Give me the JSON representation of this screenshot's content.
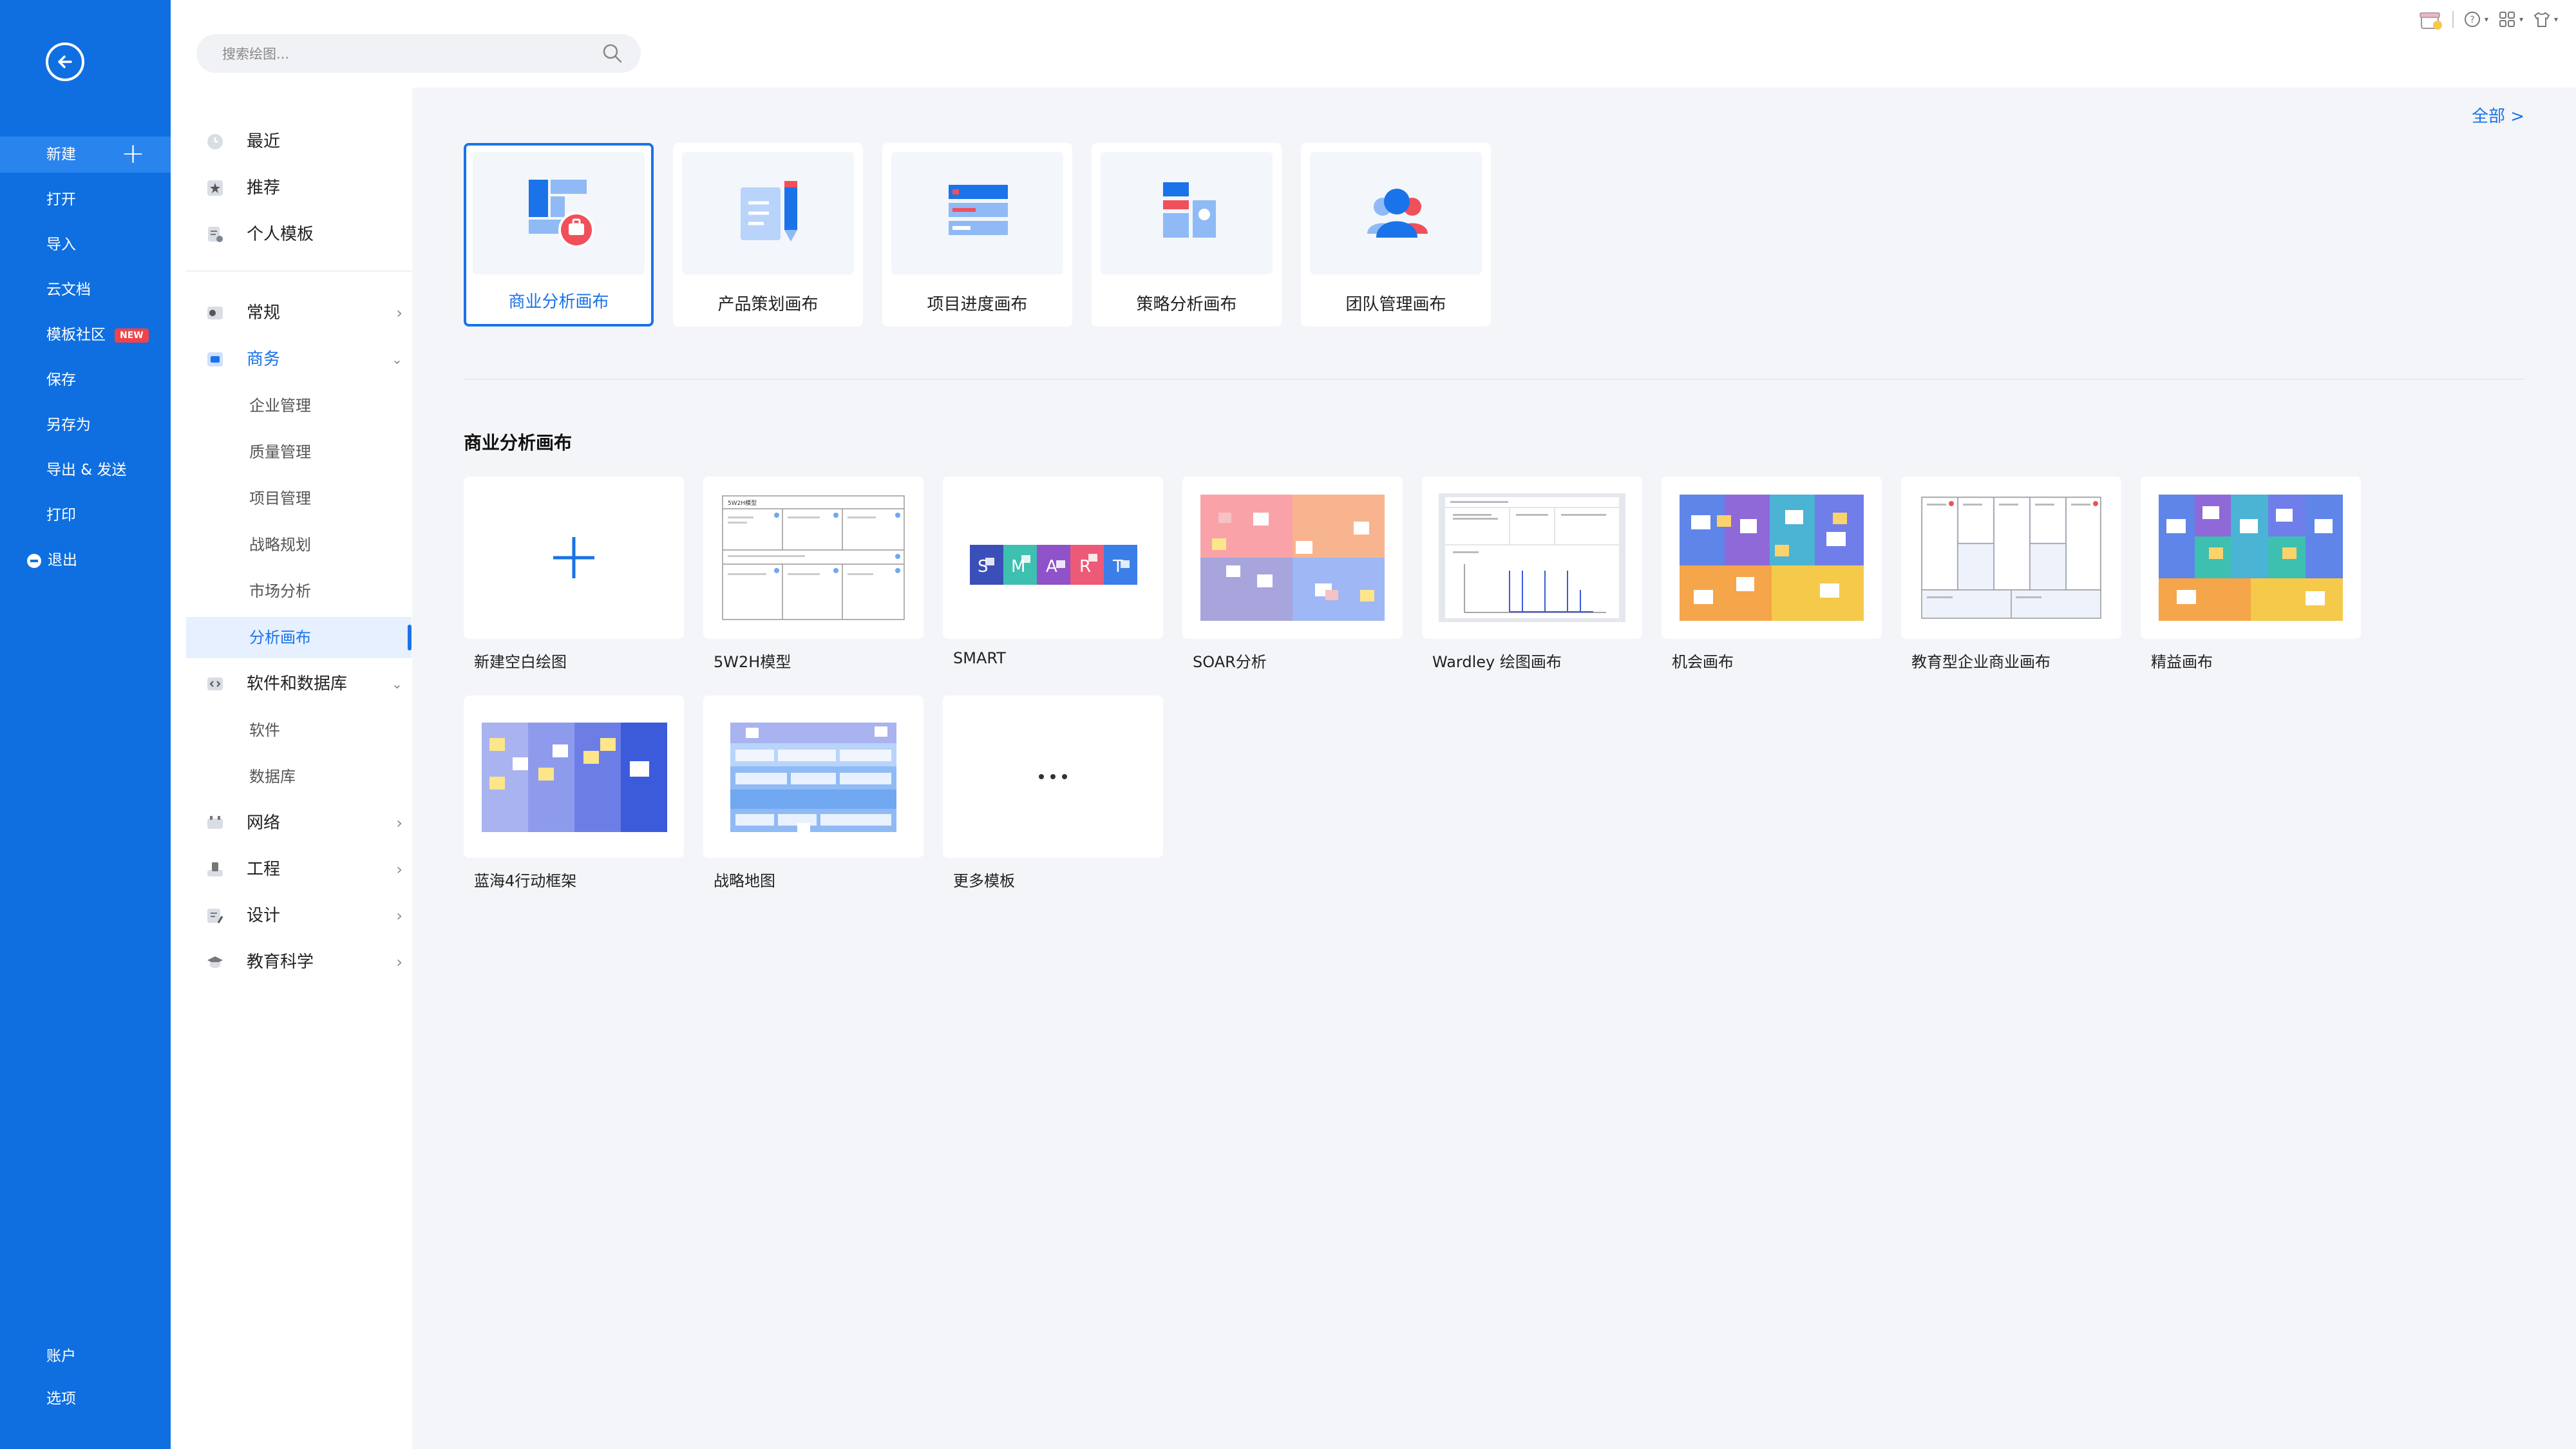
{
  "sidebar": {
    "items": [
      {
        "label": "新建"
      },
      {
        "label": "打开"
      },
      {
        "label": "导入"
      },
      {
        "label": "云文档"
      },
      {
        "label": "模板社区",
        "badge": "NEW"
      },
      {
        "label": "保存"
      },
      {
        "label": "另存为"
      },
      {
        "label": "导出 & 发送"
      },
      {
        "label": "打印"
      },
      {
        "label": "退出"
      }
    ],
    "bottom": [
      {
        "label": "账户"
      },
      {
        "label": "选项"
      }
    ]
  },
  "search": {
    "placeholder": "搜索绘图..."
  },
  "categories": {
    "top": [
      {
        "label": "最近",
        "icon": "clock-icon"
      },
      {
        "label": "推荐",
        "icon": "star-icon"
      },
      {
        "label": "个人模板",
        "icon": "personal-template-icon"
      }
    ],
    "groups": [
      {
        "label": "常规",
        "icon": "general-icon"
      },
      {
        "label": "商务",
        "icon": "business-icon",
        "expanded": true,
        "subs": [
          "企业管理",
          "质量管理",
          "项目管理",
          "战略规划",
          "市场分析",
          "分析画布"
        ]
      },
      {
        "label": "软件和数据库",
        "icon": "code-icon",
        "expanded": true,
        "subs": [
          "软件",
          "数据库"
        ]
      },
      {
        "label": "网络",
        "icon": "network-icon"
      },
      {
        "label": "工程",
        "icon": "engineering-icon"
      },
      {
        "label": "设计",
        "icon": "design-icon"
      },
      {
        "label": "教育科学",
        "icon": "education-icon"
      }
    ],
    "active_sub": "分析画布"
  },
  "main": {
    "all_link": "全部 >",
    "template_categories": [
      {
        "label": "商业分析画布",
        "selected": true
      },
      {
        "label": "产品策划画布"
      },
      {
        "label": "项目进度画布"
      },
      {
        "label": "策略分析画布"
      },
      {
        "label": "团队管理画布"
      }
    ],
    "section_title": "商业分析画布",
    "templates": [
      {
        "label": "新建空白绘图"
      },
      {
        "label": "5W2H模型"
      },
      {
        "label": "SMART"
      },
      {
        "label": "SOAR分析"
      },
      {
        "label": "Wardley 绘图画布"
      },
      {
        "label": "机会画布"
      },
      {
        "label": "教育型企业商业画布"
      },
      {
        "label": "精益画布"
      },
      {
        "label": "蓝海4行动框架"
      },
      {
        "label": "战略地图"
      },
      {
        "label": "更多模板"
      }
    ],
    "thumb_text": {
      "w2h_title": "5W2H模型",
      "smart_letters": [
        "S",
        "M",
        "A",
        "R",
        "T"
      ]
    }
  },
  "colors": {
    "accent": "#1a73e8",
    "sidebar": "#0f6fe0"
  }
}
